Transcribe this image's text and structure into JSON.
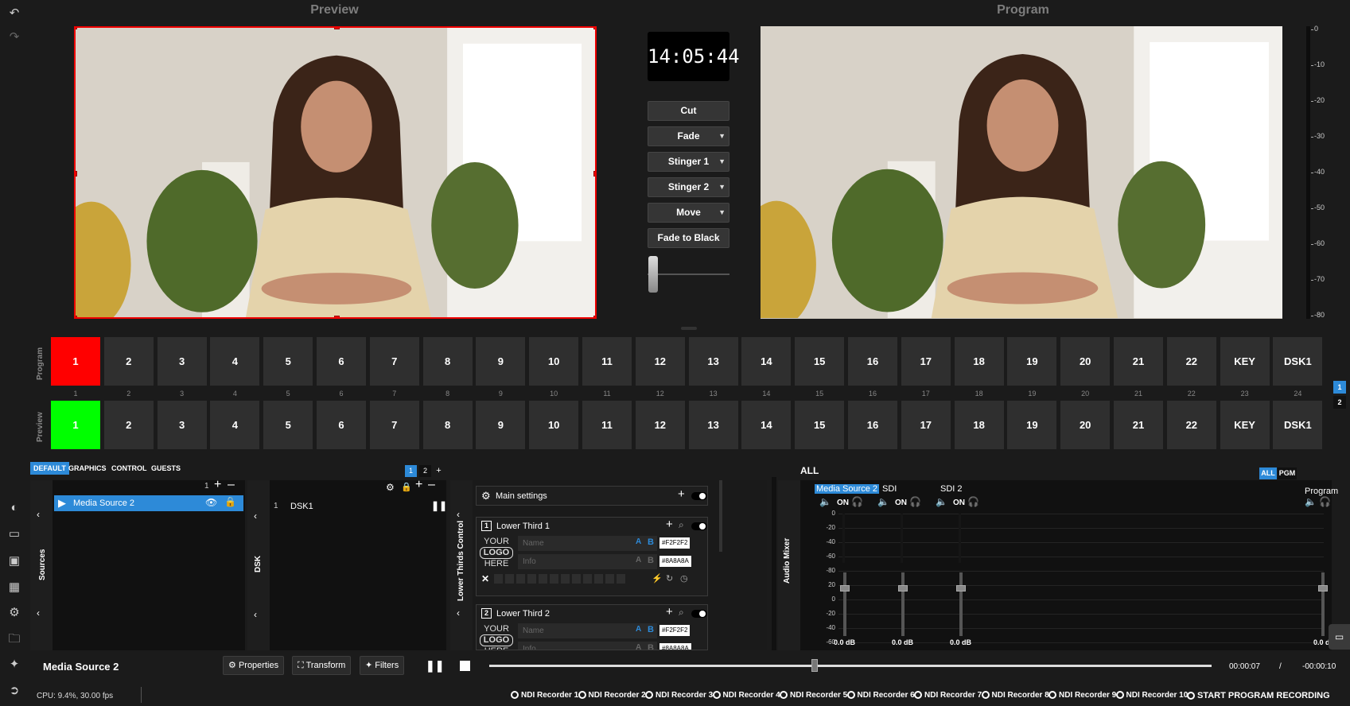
{
  "titles": {
    "preview": "Preview",
    "program": "Program"
  },
  "clock": "14:05:44",
  "transitions": [
    "Cut",
    "Fade",
    "Stinger 1",
    "Stinger 2",
    "Move",
    "Fade to Black"
  ],
  "db_scale": [
    "0",
    "-10",
    "-20",
    "-30",
    "-40",
    "-50",
    "-60",
    "-70",
    "-80"
  ],
  "switcher": {
    "program_label": "Program",
    "preview_label": "Preview",
    "buttons": [
      "1",
      "2",
      "3",
      "4",
      "5",
      "6",
      "7",
      "8",
      "9",
      "10",
      "11",
      "12",
      "13",
      "14",
      "15",
      "16",
      "17",
      "18",
      "19",
      "20",
      "21",
      "22",
      "KEY",
      "DSK1"
    ],
    "numbers": [
      "1",
      "2",
      "3",
      "4",
      "5",
      "6",
      "7",
      "8",
      "9",
      "10",
      "11",
      "12",
      "13",
      "14",
      "15",
      "16",
      "17",
      "18",
      "19",
      "20",
      "21",
      "22",
      "23",
      "24"
    ],
    "page_1": "1",
    "page_2": "2",
    "program_active_color": "#ff0000",
    "preview_active_color": "#00ff00"
  },
  "tabs": [
    "DEFAULT",
    "GRAPHICS",
    "CONTROL",
    "GUESTS"
  ],
  "sources": {
    "label": "Sources",
    "count": "1",
    "item": "Media Source 2"
  },
  "dsk": {
    "label": "DSK",
    "page1": "1",
    "page2": "2",
    "plus": "+",
    "row_num": "1",
    "row_name": "DSK1"
  },
  "lower_thirds": {
    "label": "Lower Thirds Control",
    "main_settings": "Main settings",
    "items": [
      {
        "num": "1",
        "title": "Lower Third 1",
        "name_ph": "Name",
        "info_ph": "Info",
        "color1": "#F2F2F2",
        "color2": "#8A8A8A"
      },
      {
        "num": "2",
        "title": "Lower Third 2",
        "name_ph": "Name",
        "info_ph": "Info",
        "color1": "#F2F2F2",
        "color2": "#8A8A8A"
      }
    ],
    "logo": [
      "YOUR",
      "LOGO",
      "HERE"
    ]
  },
  "audio": {
    "header": "ALL",
    "toggle_all": "ALL",
    "toggle_pgm": "PGM",
    "label": "Audio Mixer",
    "scale": [
      "0",
      "-20",
      "-40",
      "-60",
      "-80",
      "20",
      "0",
      "-20",
      "-40",
      "-60"
    ],
    "channels": [
      {
        "name": "Media Source 2",
        "on": "ON",
        "db": "0.0 dB"
      },
      {
        "name": "SDI",
        "on": "ON",
        "db": "0.0 dB"
      },
      {
        "name": "SDI 2",
        "on": "ON",
        "db": "0.0 dB"
      }
    ],
    "program": {
      "name": "Program",
      "db": "0.0 d"
    }
  },
  "bottom": {
    "source_name": "Media Source 2",
    "properties": "Properties",
    "transform": "Transform",
    "filters": "Filters",
    "time_elapsed": "00:00:07",
    "time_sep": "/",
    "time_remaining": "-00:00:10",
    "progress": 0.45
  },
  "status": {
    "cpu": "CPU: 9.4%, 30.00 fps",
    "recorders": [
      "NDI Recorder 1",
      "NDI Recorder 2",
      "NDI Recorder 3",
      "NDI Recorder 4",
      "NDI Recorder 5",
      "NDI Recorder 6",
      "NDI Recorder 7",
      "NDI Recorder 8",
      "NDI Recorder 9",
      "NDI Recorder 10"
    ],
    "start_recording": "START PROGRAM RECORDING"
  },
  "icons": [
    "undo-icon",
    "redo-icon",
    "studio-icon",
    "monitor-icon",
    "multiview-icon",
    "layout-icon",
    "settings-icon",
    "folder-icon",
    "tools-icon",
    "exit-icon"
  ]
}
